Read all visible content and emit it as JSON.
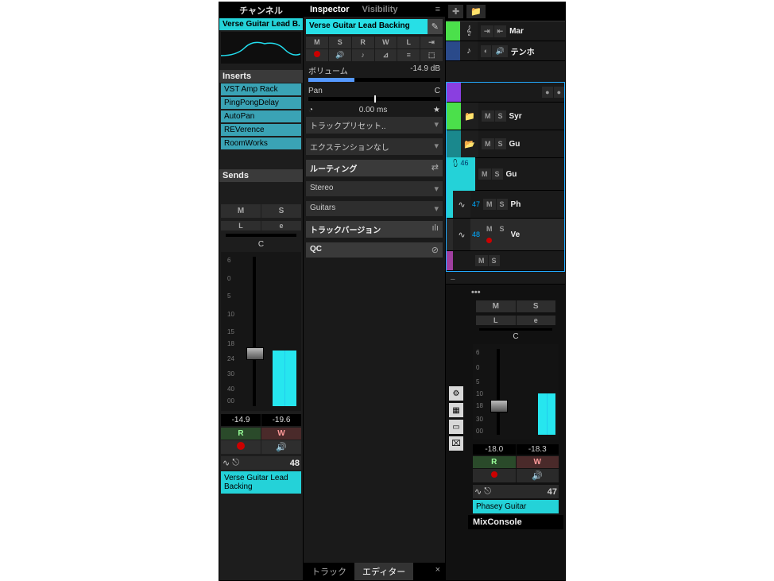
{
  "channel": {
    "title": "チャンネル",
    "track_short": "Verse Guitar Lead B.",
    "inserts_hdr": "Inserts",
    "inserts": [
      "VST Amp Rack",
      "PingPongDelay",
      "AutoPan",
      "REVerence",
      "RoomWorks"
    ],
    "sends_hdr": "Sends",
    "m": "M",
    "s": "S",
    "l": "L",
    "e": "e",
    "pan_c": "C",
    "scale": [
      "6",
      "0",
      "5",
      "10",
      "15",
      "18",
      "24",
      "30",
      "40",
      "00"
    ],
    "db": "-14.9",
    "peak": "-19.6",
    "r": "R",
    "w": "W",
    "speaker_icon": "🔊",
    "wave_icon": "∿",
    "link_icon": "⎋",
    "index": "48",
    "track_full": "Verse Guitar Lead Backing"
  },
  "inspector": {
    "tab_inspector": "Inspector",
    "tab_visibility": "Visibility",
    "menu_icon": "≡",
    "track_name": "Verse Guitar Lead Backing",
    "edit_icon": "✎",
    "btns1": [
      "M",
      "S",
      "R",
      "W",
      "L",
      "⇥"
    ],
    "btns2": [
      "●",
      "🔊",
      "♪",
      "⊿",
      "≡",
      "⬚"
    ],
    "volume_label": "ボリューム",
    "volume_db": "-14.9 dB",
    "pan_label": "Pan",
    "pan_val": "C",
    "delay_icon": "◔",
    "delay_val": "0.00 ms",
    "star": "★",
    "preset_label": "トラックプリセット..",
    "dropdown": "▾",
    "ext_label": "エクステンションなし",
    "routing_hdr": "ルーティング",
    "routing_icon": "⇄",
    "input": "Stereo",
    "output": "Guitars",
    "version_hdr": "トラックバージョン",
    "version_icon": "ılı",
    "qc_hdr": "QC",
    "qc_icon": "⊘",
    "tab_track": "トラック",
    "tab_editor": "エディター",
    "close": "×"
  },
  "tracklist": {
    "add_icon": "✚",
    "addf_icon": "📁",
    "rows": [
      {
        "color": "c-green",
        "cls": "short",
        "icon": "𝄞",
        "btns": [
          "⇥",
          "⇤"
        ],
        "name": "Mar"
      },
      {
        "color": "c-navy",
        "cls": "short",
        "icon": "♪",
        "btns": [
          "◐",
          "🔊"
        ],
        "name": "テンホ"
      },
      {
        "color": "c-purple",
        "cls": "short",
        "icon": "",
        "btns": [
          "●",
          "●"
        ],
        "name": ""
      },
      {
        "color": "c-green",
        "cls": "",
        "icon": "📁",
        "btns": [
          "M",
          "S"
        ],
        "name": "Syr"
      },
      {
        "color": "c-darkcyan",
        "cls": "",
        "icon": "📂",
        "btns": [
          "M",
          "S"
        ],
        "name": "Gu"
      },
      {
        "color": "c-cyan",
        "cls": "tall",
        "icon": "⩇",
        "idx": "46",
        "btns": [
          "M",
          "S"
        ],
        "name": "Gu"
      },
      {
        "color": "c-cyan",
        "cls": "",
        "icon": "∿",
        "idx": "47",
        "btns": [
          "M",
          "S"
        ],
        "name": "Ph"
      },
      {
        "color": "",
        "cls": "tall sel",
        "icon": "∿",
        "idx": "48",
        "btns": [
          "M",
          "S"
        ],
        "name": "Ve",
        "extra": true
      },
      {
        "color": "c-mag",
        "cls": "short",
        "icon": "",
        "btns": [
          "M",
          "S"
        ],
        "name": ""
      }
    ],
    "collapse": "–"
  },
  "mix": {
    "dots": "•••",
    "m": "M",
    "s": "S",
    "l": "L",
    "e": "e",
    "c": "C",
    "scale": [
      "6",
      "0",
      "5",
      "10",
      "18",
      "30",
      "00"
    ],
    "side_icons": [
      "⚙",
      "▦",
      "▭",
      "⌧"
    ],
    "db": "-18.0",
    "peak": "-18.3",
    "r": "R",
    "w": "W",
    "speaker": "🔊",
    "wave": "∿",
    "link": "⎋",
    "index": "47",
    "track_name": "Phasey Guitar",
    "tab": "MixConsole"
  }
}
